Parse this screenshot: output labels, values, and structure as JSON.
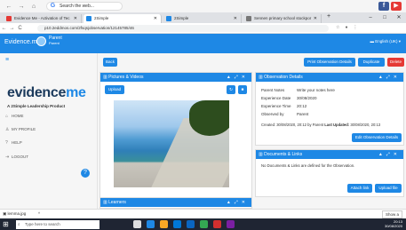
{
  "google_bar": {
    "search_text": "Search the web...",
    "nav_back": "←",
    "nav_forward": "→",
    "nav_home": "⌂",
    "badge_text": "•"
  },
  "tabs": [
    {
      "label": "Evidence Me - Activation of Tec",
      "color": "#e53935"
    },
    {
      "label": "2Simple",
      "color": "#1e88e5"
    },
    {
      "label": "2Simple",
      "color": "#1e88e5"
    },
    {
      "label": "Sennen primary school stockpor",
      "color": "#777777"
    }
  ],
  "window_controls": {
    "min": "–",
    "max": "□",
    "close": "✕"
  },
  "address": {
    "url": "p10.2eddmos.com/2fsqsjobservation/12145785/46"
  },
  "header": {
    "brand": "Evidence.me",
    "user_name": "Parent",
    "user_role": "Parent",
    "language": "English (UK)"
  },
  "sidebar": {
    "logo_main": "evidence",
    "logo_me": "me",
    "tagline": "A 2Simple Leadership Product",
    "items": [
      {
        "label": "HOME",
        "icon": "⌂"
      },
      {
        "label": "MY PROFILE",
        "icon": "♙"
      },
      {
        "label": "HELP",
        "icon": "?"
      },
      {
        "label": "LOGOUT",
        "icon": "⇥"
      }
    ],
    "fab_icon": "?"
  },
  "toolbar": {
    "back": "Back",
    "print": "Print Observation Details",
    "duplicate": "Duplicate",
    "delete": "Delete"
  },
  "pictures_panel": {
    "title": "Pictures & Videos",
    "upload": "Upload"
  },
  "observation_panel": {
    "title": "Observation Details",
    "rows": [
      {
        "k": "Parent Notes",
        "v": "Write your notes here"
      },
      {
        "k": "Experience Date",
        "v": "30/08/2020"
      },
      {
        "k": "Experience Time",
        "v": "20:12"
      },
      {
        "k": "Observed by",
        "v": "Parent"
      }
    ],
    "created": "Created: 30/08/2020, 20:12 by Parent",
    "last_updated_label": "Last Updated:",
    "last_updated": "30/08/2020, 20:13",
    "edit": "Edit Observation Details"
  },
  "documents_panel": {
    "title": "Documents & Links",
    "empty_text": "No Documents & Links are defined for the Observation.",
    "attach": "Attach link",
    "upload": "Upload file"
  },
  "learners_panel": {
    "title": "Learners"
  },
  "download": {
    "file": "lemma.jpg",
    "show_all": "Show a"
  },
  "taskbar": {
    "search_placeholder": "Type here to search",
    "time": "20:13",
    "date": "30/08/2020"
  },
  "colors": {
    "primary": "#1e88e5",
    "danger": "#e53935"
  }
}
